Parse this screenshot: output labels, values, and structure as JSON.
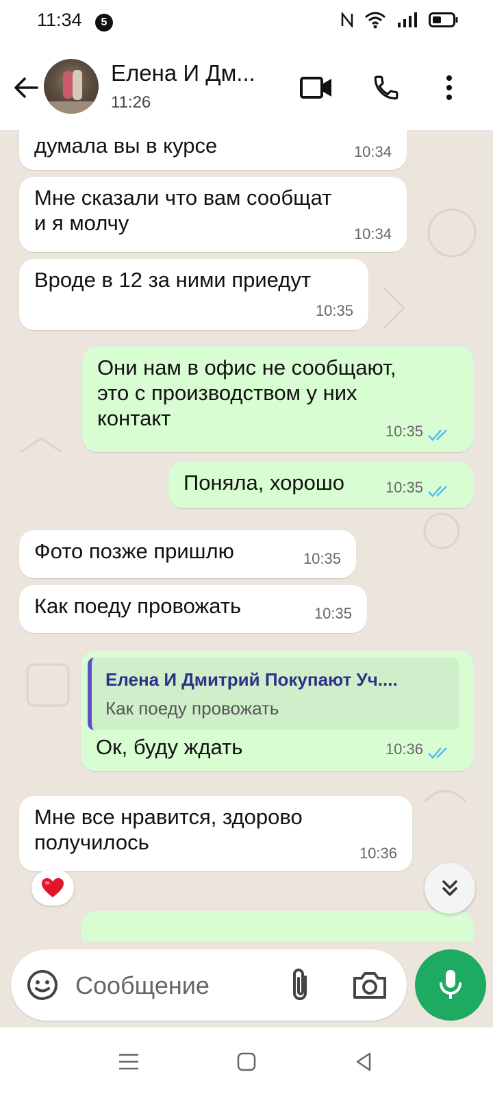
{
  "status_bar": {
    "time": "11:34",
    "notification_count": "5"
  },
  "header": {
    "contact_name": "Елена И Дм...",
    "last_seen": "11:26"
  },
  "messages": [
    {
      "direction": "in",
      "text": "думала вы в курсе",
      "time": "10:34"
    },
    {
      "direction": "in",
      "text": "Мне сказали что вам сообщат\nи я молчу",
      "time": "10:34"
    },
    {
      "direction": "in",
      "text": "Вроде в 12 за ними приедут",
      "time": "10:35"
    },
    {
      "direction": "out",
      "text": "Они нам в офис не сообщают,\nэто с производством у них\nконтакт",
      "time": "10:35",
      "status": "read"
    },
    {
      "direction": "out",
      "text": "Поняла, хорошо",
      "time": "10:35",
      "status": "read"
    },
    {
      "direction": "in",
      "text": "Фото позже пришлю",
      "time": "10:35"
    },
    {
      "direction": "in",
      "text": "Как поеду провожать",
      "time": "10:35"
    },
    {
      "direction": "out",
      "text": "Ок, буду ждать",
      "time": "10:36",
      "status": "read",
      "quote": {
        "author": "Елена И Дмитрий Покупают Уч....",
        "text": "Как поеду провожать"
      }
    },
    {
      "direction": "in",
      "text": "Мне все нравится, здорово\nполучилось",
      "time": "10:36",
      "reaction": "heart-emoji"
    }
  ],
  "composer": {
    "placeholder": "Сообщение"
  },
  "colors": {
    "outgoing_bubble": "#d9fdd3",
    "incoming_bubble": "#ffffff",
    "read_ticks": "#53bdeb",
    "mic_button": "#1dab61",
    "chat_background": "#ece5dd"
  },
  "icons": [
    "back-arrow-icon",
    "video-call-icon",
    "phone-icon",
    "more-vert-icon",
    "double-check-icon",
    "heart-emoji",
    "chevron-double-down-icon",
    "sticker-icon",
    "paperclip-icon",
    "camera-icon",
    "mic-icon"
  ]
}
